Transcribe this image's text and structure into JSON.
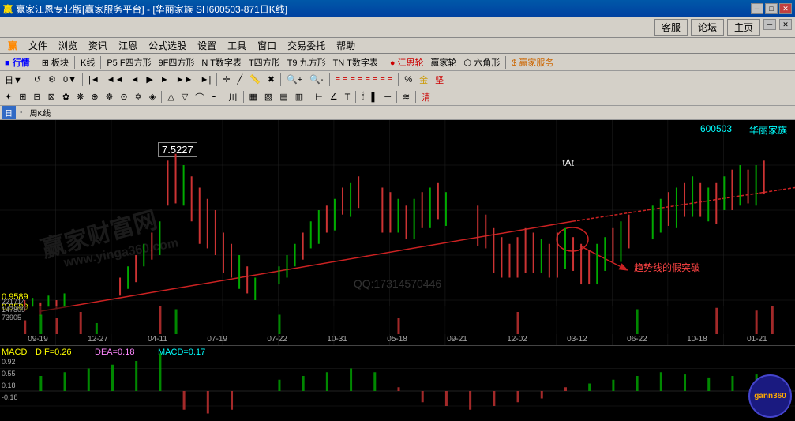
{
  "titlebar": {
    "title": "赢家江恩专业版[赢家服务平台] - [华丽家族    SH600503-871日K线]",
    "win_icon": "赢",
    "buttons": [
      "_",
      "□",
      "×"
    ]
  },
  "top_buttons": [
    "客服",
    "论坛",
    "主页"
  ],
  "menubar": {
    "items": [
      "赢",
      "文件",
      "浏览",
      "资讯",
      "江恩",
      "公式选股",
      "设置",
      "工具",
      "窗口",
      "交易委托",
      "帮助"
    ]
  },
  "toolbar1": {
    "items": [
      "行情",
      "板块",
      "K线",
      "P5 F四方形",
      "9F四方形",
      "N T数字表",
      "T四方形",
      "T9 九方形",
      "TN T数字表",
      "江恩轮",
      "赢家轮",
      "六角形",
      "赢家服务"
    ]
  },
  "chart_period": {
    "current": "日",
    "label": "日K线"
  },
  "chart": {
    "stock_code": "600503",
    "stock_name": "华丽家族",
    "price_high": "7.5227",
    "price_current_level": "0.9589",
    "price_level2": "0.9589",
    "dates": [
      "09-19",
      "12-27",
      "04-11",
      "07-19",
      "07-22",
      "10-31",
      "05-18",
      "09-21",
      "12-02",
      "03-12",
      "06-22",
      "10-18",
      "01-21"
    ],
    "annotation_text": "趋势线的假突破",
    "macd": {
      "dif": "DIF=0.26",
      "dea": "DEA=0.18",
      "macd_val": "MACD=0.17",
      "values": [
        "0.92",
        "0.55",
        "0.18",
        "-0.18"
      ],
      "label": "MACD"
    },
    "volume_labels": [
      "221714",
      "147809",
      "73905"
    ],
    "watermark": "www.yinga360.com",
    "qq": "QQ:17314570446",
    "tAt_label": "tAt"
  },
  "icons": {
    "minimize": "─",
    "maximize": "□",
    "close": "✕",
    "nav_prev": "◄",
    "nav_next": "►"
  }
}
